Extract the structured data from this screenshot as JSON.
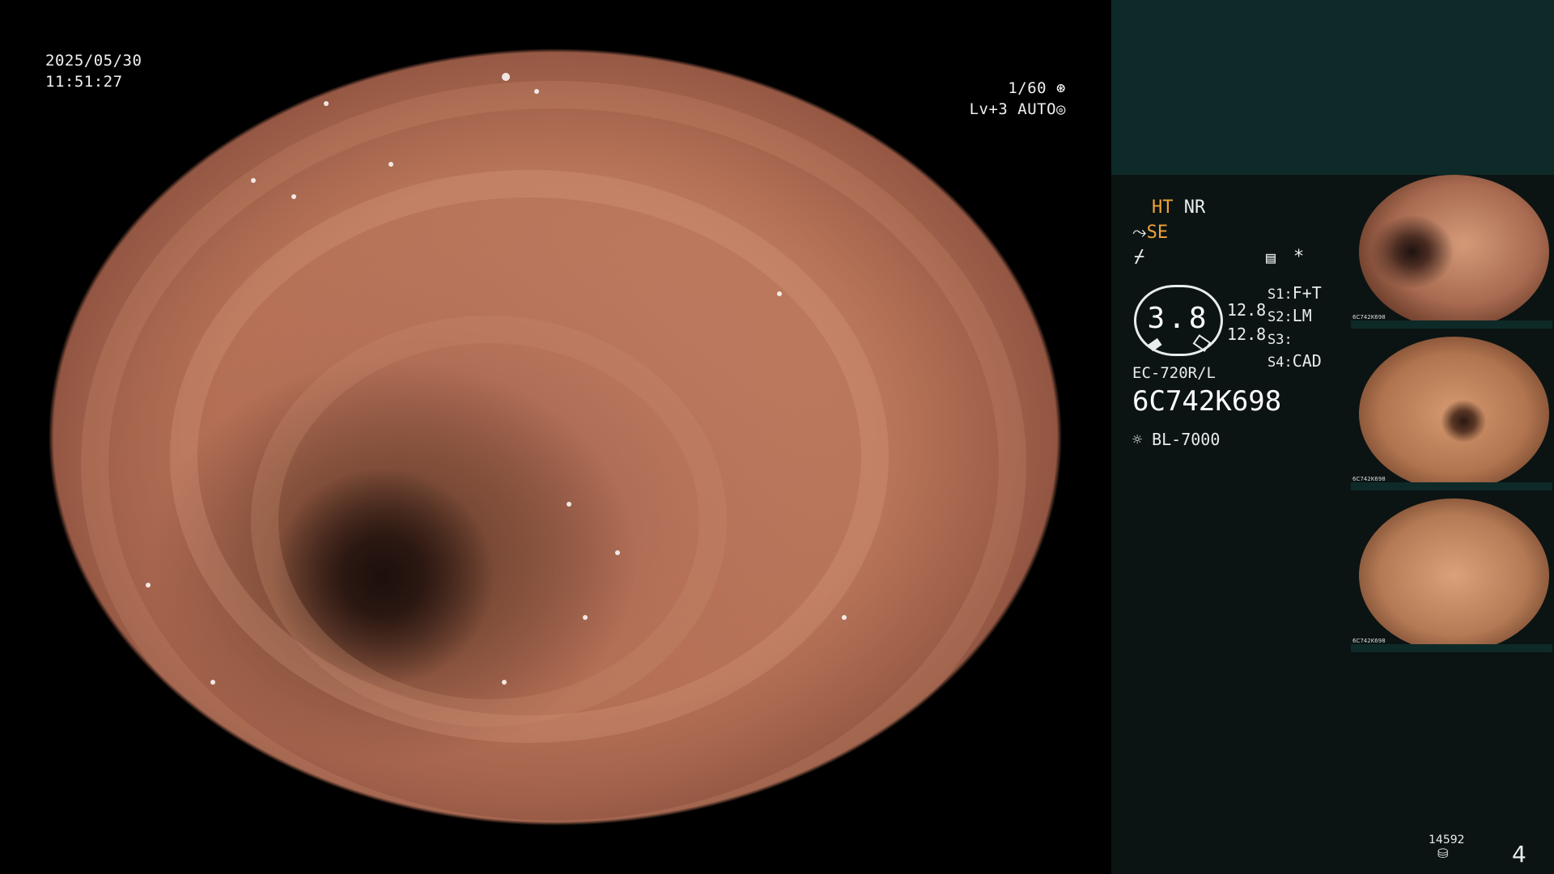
{
  "osd": {
    "date": "2025/05/30",
    "time": "11:51:27",
    "shutter": "1/60",
    "level": "Lv+3 AUTO"
  },
  "panel": {
    "ht": "HT",
    "nr": "NR",
    "se": "SE",
    "gauge_value": "3.8",
    "gauge_right_top": "12.8",
    "gauge_right_bottom": "12.8",
    "s1_label": "S1:",
    "s1_value": "F+T",
    "s2_label": "S2:",
    "s2_value": "LM",
    "s3_label": "S3:",
    "s3_value": "",
    "s4_label": "S4:",
    "s4_value": "CAD",
    "asterisk": "*",
    "scope_model": "EC-720R/L",
    "serial": "6C742K698",
    "light_source": "BL-7000",
    "counter": "14592",
    "page_number": "4"
  },
  "thumbnails": [
    {
      "caption": "6C742K698"
    },
    {
      "caption": "6C742K698"
    },
    {
      "caption": "6C742K698"
    }
  ],
  "colors": {
    "panel_bg": "#0b1413",
    "panel_top": "#0e2a28",
    "accent_orange": "#f0a33a",
    "text": "#e8ecec"
  }
}
